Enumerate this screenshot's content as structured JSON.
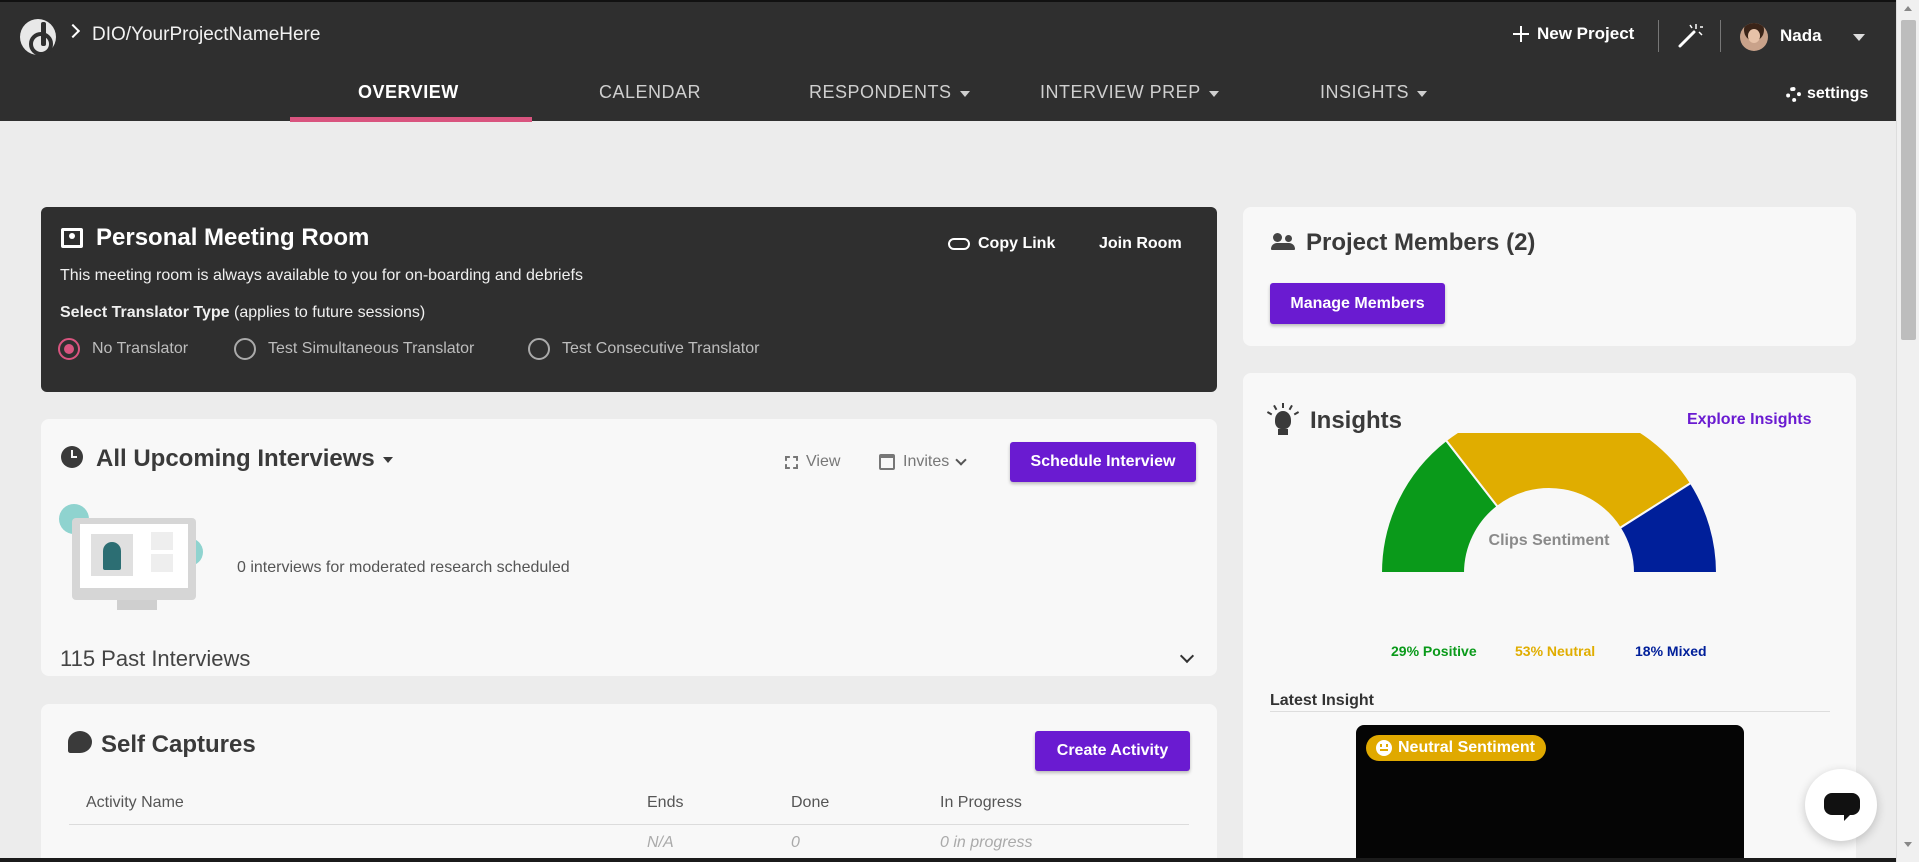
{
  "breadcrumb": "DIO/YourProjectNameHere",
  "header": {
    "new_project": "New Project",
    "username": "Nada",
    "settings": "settings"
  },
  "nav": {
    "overview": "OVERVIEW",
    "calendar": "CALENDAR",
    "respondents": "RESPONDENTS",
    "interview_prep": "INTERVIEW PREP",
    "insights": "INSIGHTS"
  },
  "meeting_room": {
    "title": "Personal Meeting Room",
    "description": "This meeting room is always available to you for on-boarding and debriefs",
    "translator_label": "Select Translator Type",
    "translator_note": " (applies to future sessions)",
    "options": [
      "No Translator",
      "Test Simultaneous Translator",
      "Test Consecutive Translator"
    ],
    "selected": "No Translator",
    "copy_link": "Copy Link",
    "join_room": "Join Room"
  },
  "interviews": {
    "title": "All Upcoming Interviews",
    "view": "View",
    "invites": "Invites",
    "schedule": "Schedule Interview",
    "empty_message": "0 interviews for moderated research scheduled",
    "past": "115 Past Interviews"
  },
  "self_captures": {
    "title": "Self Captures",
    "create": "Create Activity",
    "columns": [
      "Activity Name",
      "Ends",
      "Done",
      "In Progress"
    ],
    "row": [
      "",
      "N/A",
      "0",
      "0 in progress"
    ]
  },
  "members": {
    "title": "Project Members (2)",
    "manage": "Manage Members"
  },
  "insights_card": {
    "title": "Insights",
    "explore": "Explore Insights",
    "latest": "Latest Insight",
    "badge": "Neutral Sentiment"
  },
  "chart_data": {
    "type": "pie",
    "title": "Clips Sentiment",
    "series": [
      {
        "name": "Positive",
        "value": 29,
        "label": "29% Positive",
        "color": "#0a9a1a"
      },
      {
        "name": "Neutral",
        "value": 53,
        "label": "53% Neutral",
        "color": "#e0ad00"
      },
      {
        "name": "Mixed",
        "value": 18,
        "label": "18% Mixed",
        "color": "#001f9a"
      }
    ]
  }
}
